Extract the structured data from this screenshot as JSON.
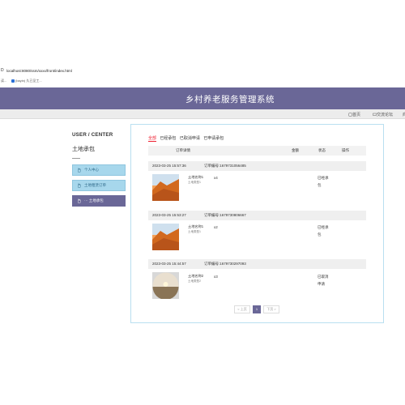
{
  "browser": {
    "nav_glyph": "D",
    "url": "localhost:8080/ssm/xxxx/front/index.html",
    "bookmarks": [
      "读...",
      "(bayin) 久已见工..."
    ]
  },
  "header": {
    "title": "乡村养老服务管理系统"
  },
  "subnav": {
    "home": "首页",
    "forum": "交流论坛",
    "more": "商"
  },
  "sidebar": {
    "title": "USER / CENTER",
    "subtitle": "土地承包",
    "items": [
      {
        "label": "个人中心",
        "active": false
      },
      {
        "label": "土地租赁订单",
        "active": false
      },
      {
        "label": "土地承包",
        "active": true
      }
    ]
  },
  "tabs": [
    "全部",
    "已经承包",
    "已取消申请",
    "已申请承包"
  ],
  "table": {
    "headers": {
      "details": "订单详情",
      "amount": "金额",
      "status": "状态",
      "action": "操作"
    }
  },
  "orders": [
    {
      "date": "2023-03-25 15:57:36",
      "order_no": "订单编号:1679731056485",
      "name": "土地名称1",
      "type": "土地类型1",
      "qty": "x4",
      "status": "已经承包",
      "image": "desert-landscape-photo"
    },
    {
      "date": "2023-03-25 15:53:27",
      "order_no": "订单编号:1679730806667",
      "name": "土地名称1",
      "type": "土地类型1",
      "qty": "x2",
      "status": "已经承包",
      "image": "desert-landscape-photo"
    },
    {
      "date": "2023-03-25 15:44:57",
      "order_no": "订单编号:1679730297093",
      "name": "土地名称2",
      "type": "土地类型2",
      "qty": "x3",
      "status": "已取消申请",
      "image": "fisheye-field-photo"
    }
  ],
  "pager": {
    "prev": "上页",
    "current": "1",
    "next": "下页"
  },
  "colors": {
    "accent": "#6a6797",
    "menu_light": "#a7d7ec",
    "tab_active": "#e22233"
  }
}
